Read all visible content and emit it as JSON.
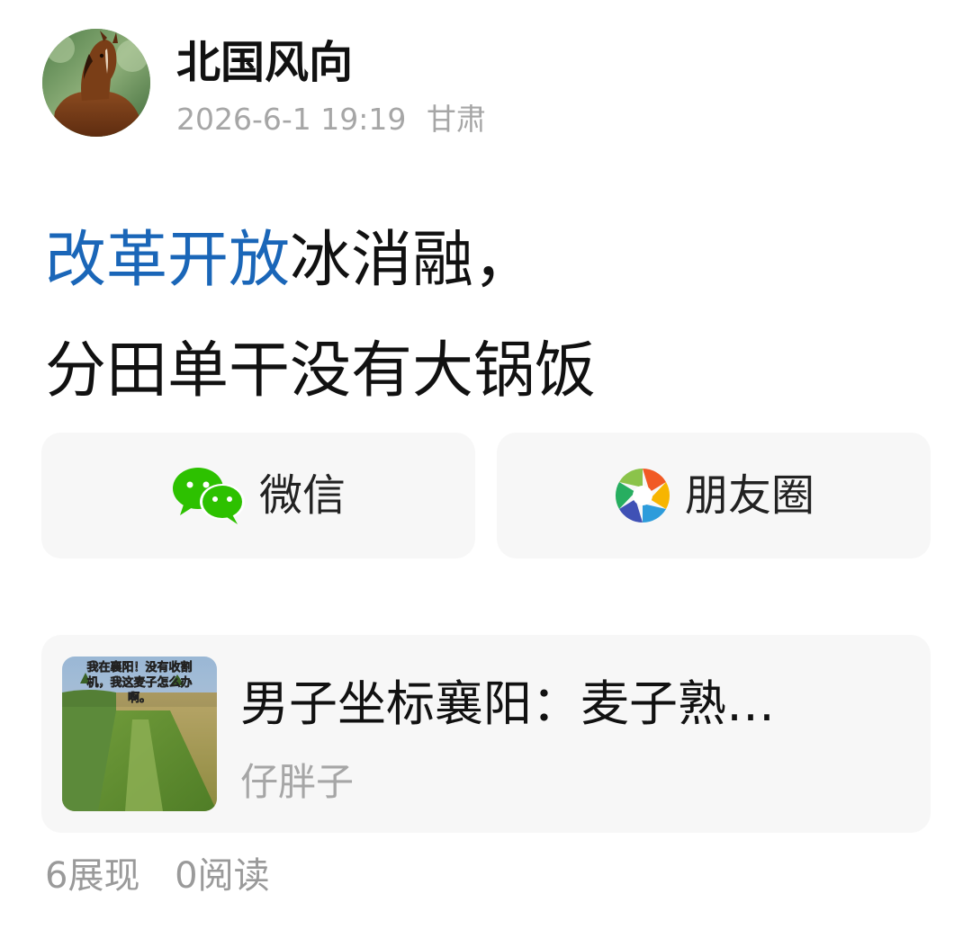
{
  "post": {
    "author": "北国风向",
    "timestamp": "2026-6-1 19:19",
    "location": "甘肃",
    "avatar_icon": "horse-avatar",
    "link_text": "改革开放",
    "line1_rest": "冰消融，",
    "line2": "分田单干没有大锅饭",
    "link_color": "#1a66b8"
  },
  "share": {
    "wechat_label": "微信",
    "wechat_icon": "wechat-icon",
    "moments_label": "朋友圈",
    "moments_icon": "moments-icon"
  },
  "card": {
    "title": "男子坐标襄阳：麦子熟…",
    "source": "仔胖子",
    "thumb_caption_line1": "我在襄阳！没有收割",
    "thumb_caption_line2": "机，我这麦子怎么办",
    "thumb_caption_line3": "啊。"
  },
  "stats": {
    "impressions": "6展现",
    "reads": "0阅读"
  }
}
